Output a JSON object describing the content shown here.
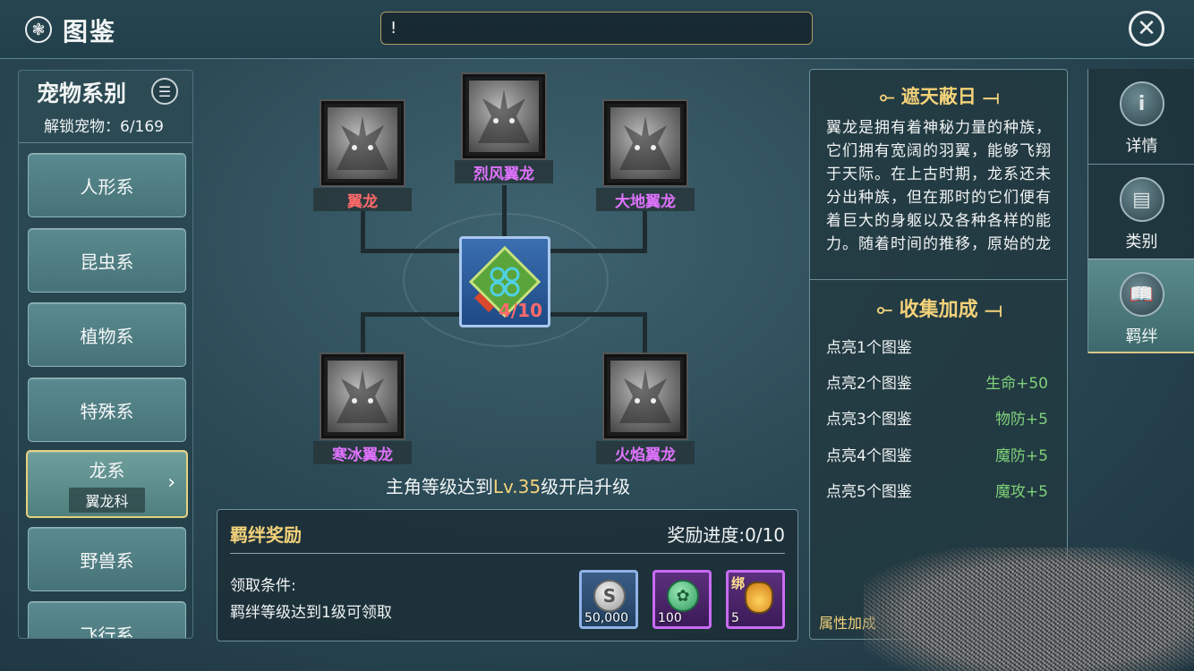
{
  "header": {
    "title": "图鉴",
    "chat_input_value": "!"
  },
  "sidebar": {
    "title": "宠物系别",
    "unlocked": "解锁宠物：6/169",
    "categories": [
      {
        "label": "人形系"
      },
      {
        "label": "昆虫系"
      },
      {
        "label": "植物系"
      },
      {
        "label": "特殊系"
      },
      {
        "label": "龙系",
        "sub": "翼龙科",
        "active": true
      },
      {
        "label": "野兽系"
      },
      {
        "label": "飞行系"
      }
    ]
  },
  "tree": {
    "pets": [
      {
        "name": "翼龙",
        "color": "#ff6a6a"
      },
      {
        "name": "烈风翼龙",
        "color": "#e173ff"
      },
      {
        "name": "大地翼龙",
        "color": "#e173ff"
      },
      {
        "name": "寒冰翼龙",
        "color": "#e173ff"
      },
      {
        "name": "火焰翼龙",
        "color": "#e173ff"
      }
    ],
    "center_count": "4/10",
    "unlock_tip_pre": "主角等级达到",
    "unlock_tip_lv": "Lv.35",
    "unlock_tip_post": "级开启升级"
  },
  "reward": {
    "title": "羁绊奖励",
    "progress": "奖励进度:0/10",
    "condition_label": "领取条件:",
    "condition_text": "羁绊等级达到1级可领取",
    "items": [
      {
        "icon": "silver-coin-icon",
        "qty": "50,000",
        "rarity": "blue"
      },
      {
        "icon": "paw-token-icon",
        "qty": "100",
        "rarity": "purple"
      },
      {
        "icon": "potion-icon",
        "qty": "5",
        "bind": "绑",
        "rarity": "purple"
      }
    ]
  },
  "info": {
    "title": "遮天蔽日",
    "desc": "翼龙是拥有着神秘力量的种族，它们拥有宽阔的羽翼，能够飞翔于天际。在上古时期，龙系还未分出种族，但在那时的它们便有着巨大的身躯以及各种各样的能力。随着时间的推移，原始的龙",
    "bonus_title": "收集加成",
    "bonuses": [
      {
        "label": "点亮1个图鉴",
        "value": ""
      },
      {
        "label": "点亮2个图鉴",
        "value": "生命+50"
      },
      {
        "label": "点亮3个图鉴",
        "value": "物防+5"
      },
      {
        "label": "点亮4个图鉴",
        "value": "魔防+5"
      },
      {
        "label": "点亮5个图鉴",
        "value": "魔攻+5"
      }
    ],
    "footer": "属性加成"
  },
  "right_tabs": [
    {
      "label": "详情",
      "icon": "info-icon"
    },
    {
      "label": "类别",
      "icon": "book-category-icon"
    },
    {
      "label": "羁绊",
      "icon": "open-book-icon",
      "active": true
    }
  ]
}
